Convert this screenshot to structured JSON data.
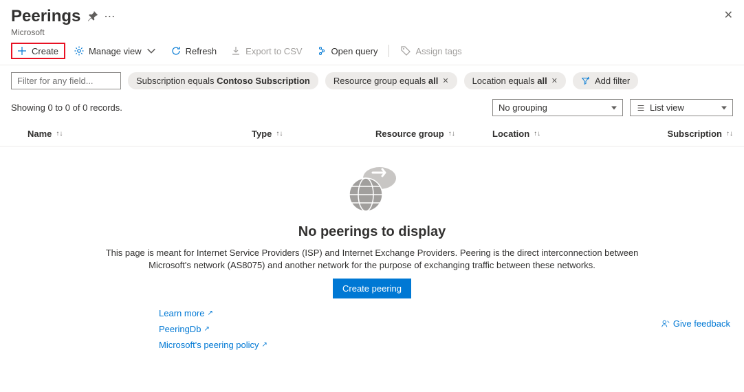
{
  "header": {
    "title": "Peerings",
    "subtitle": "Microsoft"
  },
  "toolbar": {
    "create": "Create",
    "manage_view": "Manage view",
    "refresh": "Refresh",
    "export_csv": "Export to CSV",
    "open_query": "Open query",
    "assign_tags": "Assign tags"
  },
  "filters": {
    "placeholder": "Filter for any field...",
    "pills": [
      {
        "prefix": "Subscription equals ",
        "bold": "Contoso Subscription",
        "closable": false
      },
      {
        "prefix": "Resource group equals ",
        "bold": "all",
        "closable": true
      },
      {
        "prefix": "Location equals ",
        "bold": "all",
        "closable": true
      }
    ],
    "add_filter": "Add filter"
  },
  "status": {
    "records": "Showing 0 to 0 of 0 records.",
    "grouping": "No grouping",
    "view": "List view"
  },
  "columns": {
    "name": "Name",
    "type": "Type",
    "resource_group": "Resource group",
    "location": "Location",
    "subscription": "Subscription"
  },
  "empty": {
    "title": "No peerings to display",
    "desc": "This page is meant for Internet Service Providers (ISP) and Internet Exchange Providers. Peering is the direct interconnection between Microsoft's network (AS8075) and another network for the purpose of exchanging traffic between these networks.",
    "button": "Create peering",
    "links": {
      "learn_more": "Learn more",
      "peeringdb": "PeeringDb",
      "policy": "Microsoft's peering policy"
    },
    "feedback": "Give feedback"
  }
}
